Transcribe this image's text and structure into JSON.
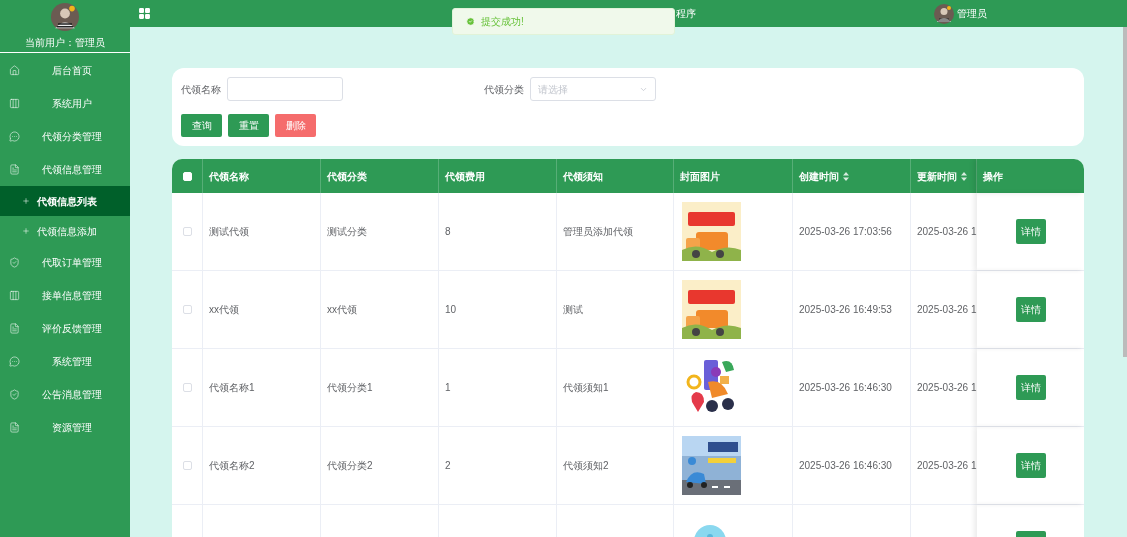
{
  "sidebar": {
    "current_user_label": "当前用户：",
    "current_user": "管理员",
    "items": [
      {
        "label": "后台首页",
        "kind": "home",
        "selected": false
      },
      {
        "label": "系统用户",
        "kind": "columns",
        "selected": false
      },
      {
        "label": "代领分类管理",
        "kind": "chat",
        "selected": false
      },
      {
        "label": "代领信息管理",
        "kind": "doc",
        "selected": false,
        "children": [
          {
            "label": "代领信息列表",
            "selected": true
          },
          {
            "label": "代领信息添加",
            "selected": false
          }
        ]
      },
      {
        "label": "代取订单管理",
        "kind": "shield",
        "selected": false
      },
      {
        "label": "接单信息管理",
        "kind": "columns",
        "selected": false
      },
      {
        "label": "评价反馈管理",
        "kind": "doc",
        "selected": false
      },
      {
        "label": "系统管理",
        "kind": "chat",
        "selected": false
      },
      {
        "label": "公告消息管理",
        "kind": "shield",
        "selected": false
      },
      {
        "label": "资源管理",
        "kind": "doc",
        "selected": false
      }
    ]
  },
  "header": {
    "title": "程序",
    "user": "管理员"
  },
  "toast": {
    "text": "提交成功!"
  },
  "search": {
    "fields": [
      {
        "label": "代领名称",
        "kind": "text"
      },
      {
        "label": "代领分类",
        "kind": "select",
        "placeholder": "请选择"
      }
    ],
    "buttons": [
      {
        "label": "查询",
        "kind": "primary"
      },
      {
        "label": "重置",
        "kind": "primary"
      },
      {
        "label": "删除",
        "kind": "danger"
      }
    ]
  },
  "table": {
    "columns": [
      {
        "label": "代领名称",
        "sortable": false
      },
      {
        "label": "代领分类",
        "sortable": false
      },
      {
        "label": "代领费用",
        "sortable": false
      },
      {
        "label": "代领须知",
        "sortable": false
      },
      {
        "label": "封面图片",
        "sortable": false
      },
      {
        "label": "创建时间",
        "sortable": true
      },
      {
        "label": "更新时间",
        "sortable": true
      },
      {
        "label": "操作",
        "sortable": false
      }
    ],
    "header_checked": false,
    "rows": [
      {
        "checked": false,
        "cells": [
          "测试代领",
          "测试分类",
          "8",
          "管理员添加代领"
        ],
        "created": "2025-03-26 17:03:56",
        "updated": "2025-03-26 1",
        "action": "详情"
      },
      {
        "checked": false,
        "cells": [
          "xx代领",
          "xx代领",
          "10",
          "测试"
        ],
        "created": "2025-03-26 16:49:53",
        "updated": "2025-03-26 1",
        "action": "详情"
      },
      {
        "checked": false,
        "cells": [
          "代领名称1",
          "代领分类1",
          "1",
          "代领须知1"
        ],
        "created": "2025-03-26 16:46:30",
        "updated": "2025-03-26 1",
        "action": "详情"
      },
      {
        "checked": false,
        "cells": [
          "代领名称2",
          "代领分类2",
          "2",
          "代领须知2"
        ],
        "created": "2025-03-26 16:46:30",
        "updated": "2025-03-26 1",
        "action": "详情"
      }
    ]
  }
}
